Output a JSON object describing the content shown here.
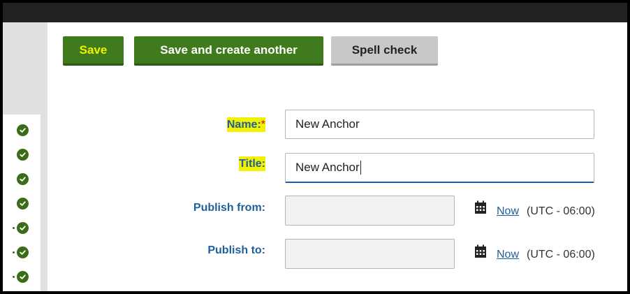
{
  "toolbar": {
    "save_label": "Save",
    "save_another_label": "Save and create another",
    "spell_check_label": "Spell check"
  },
  "form": {
    "name": {
      "label": "Name:",
      "required_mark": "*",
      "value": "New Anchor"
    },
    "title": {
      "label": "Title:",
      "value": "New Anchor"
    },
    "publish_from": {
      "label": "Publish from:",
      "value": "",
      "now_label": "Now",
      "timezone": "(UTC - 06:00)"
    },
    "publish_to": {
      "label": "Publish to:",
      "value": "",
      "now_label": "Now",
      "timezone": "(UTC - 06:00)"
    }
  },
  "sidebar": {
    "status_icons": [
      "check-icon",
      "check-icon",
      "check-icon",
      "check-icon",
      "check-icon",
      "check-icon",
      "check-icon"
    ]
  },
  "colors": {
    "primary_green": "#3f7b1c",
    "highlight_yellow": "#f2f200",
    "label_blue": "#1f5f9a",
    "required_red": "#d01010"
  }
}
